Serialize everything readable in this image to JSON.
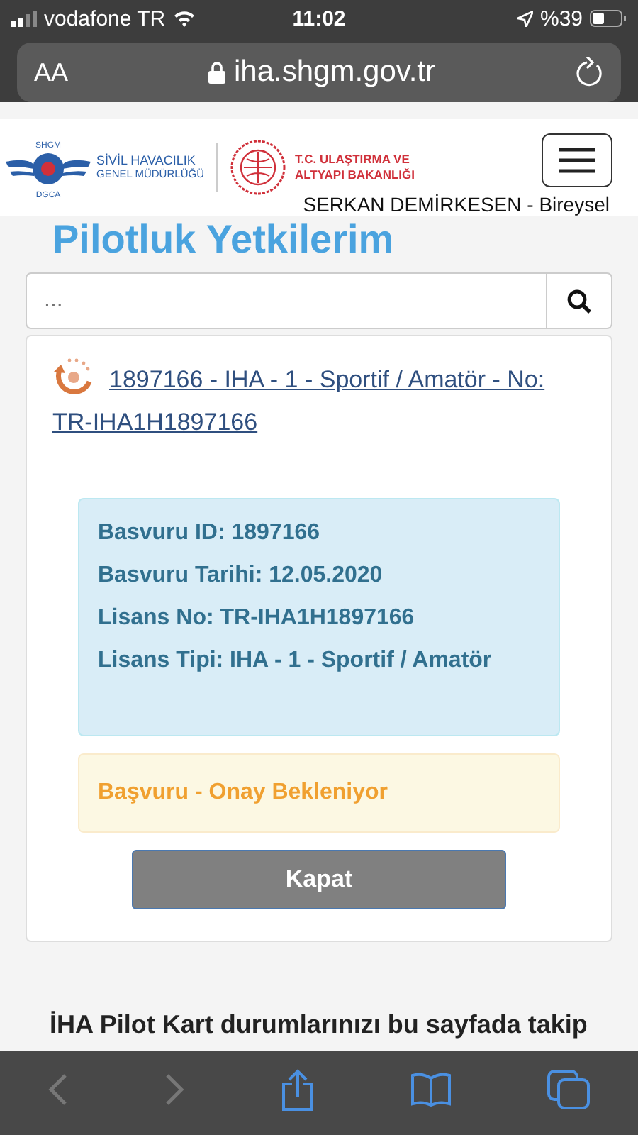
{
  "status_bar": {
    "carrier": "vodafone TR",
    "time": "11:02",
    "battery": "%39"
  },
  "browser": {
    "text_size": "AA",
    "url": "iha.shgm.gov.tr"
  },
  "header": {
    "logo_letters_top": "SHGM",
    "logo_letters_bottom": "DGCA",
    "org_line_1": "SİVİL HAVACILIK",
    "org_line_2": "GENEL MÜDÜRLÜĞÜ",
    "ministry_line_1": "T.C. ULAŞTIRMA VE",
    "ministry_line_2": "ALTYAPI BAKANLIĞI",
    "user": "SERKAN DEMİRKESEN - Bireysel"
  },
  "page_title": "Pilotluk Yetkilerim",
  "search": {
    "placeholder": "..."
  },
  "license": {
    "link": "1897166 - IHA - 1 - Sportif / Amatör - No: TR-IHA1H1897166",
    "details": [
      "Basvuru ID: 1897166",
      "Basvuru Tarihi: 12.05.2020",
      "Lisans No: TR-IHA1H1897166",
      "Lisans Tipi: IHA - 1 - Sportif / Amatör"
    ],
    "status": "Başvuru - Onay Bekleniyor",
    "close_button": "Kapat"
  },
  "footer_text": "İHA Pilot Kart durumlarınızı bu sayfada takip",
  "toolbar": {
    "back_disabled": true,
    "forward_disabled": true
  }
}
